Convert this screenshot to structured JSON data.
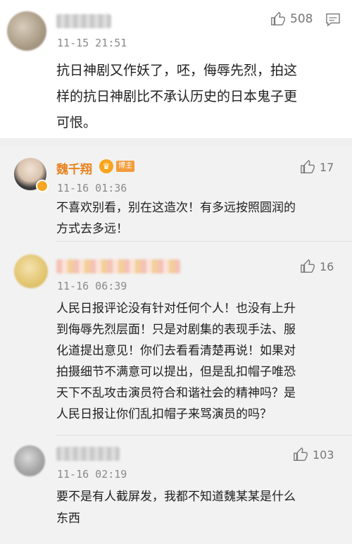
{
  "comments": [
    {
      "timestamp": "11-15 21:51",
      "likes": "508",
      "text": "抗日神剧又作妖了，呸，侮辱先烈，拍这\n样的抗日神剧比不承认历史的日本鬼子更\n可恨。"
    },
    {
      "username": "魏千翔",
      "badge": "博主",
      "timestamp": "11-16 01:36",
      "likes": "17",
      "text": "不喜欢别看，别在这造次！有多远按照圆润的\n方式去多远！"
    },
    {
      "timestamp": "11-16 06:39",
      "likes": "16",
      "text": "人民日报评论没有针对任何个人！也没有上升\n到侮辱先烈层面！只是对剧集的表现手法、服\n化道提出意见！你们去看看清楚再说！如果对\n拍摄细节不满意可以提出，但是乱扣帽子唯恐\n天下不乱攻击演员符合和谐社会的精神吗？是\n人民日报让你们乱扣帽子来骂演员的吗？"
    },
    {
      "timestamp": "11-16 02:19",
      "likes": "103",
      "text": "要不是有人截屏发，我都不知道魏某某是什么\n东西"
    }
  ],
  "icons": {
    "like": "thumbs-up-icon",
    "comment": "comment-icon",
    "accent": "#e8831f"
  }
}
